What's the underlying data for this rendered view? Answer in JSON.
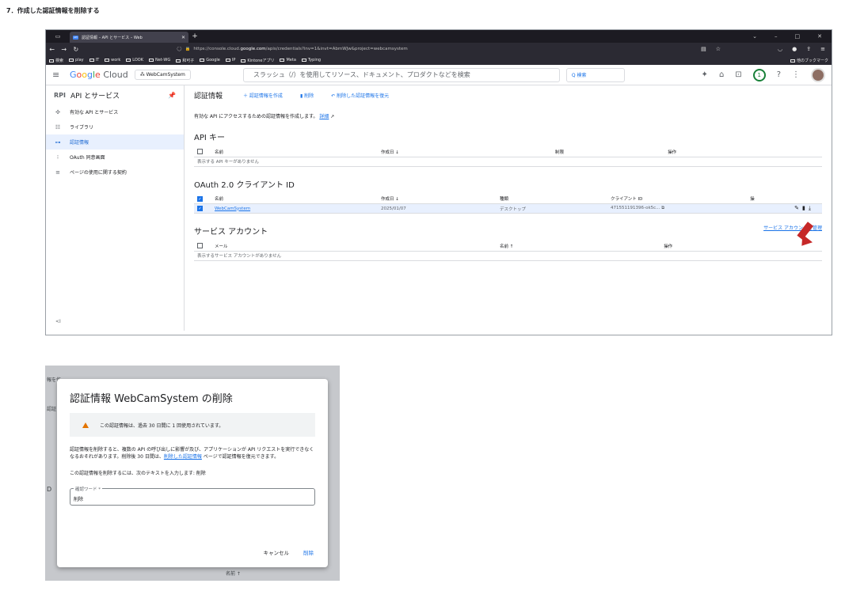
{
  "step_heading": "7．作成した認証情報を削除する",
  "browser": {
    "tab_title": "認証情報 – API とサービス – Web",
    "url_prefix": "https://console.cloud.",
    "url_domain": "google.com",
    "url_rest": "/apis/credentials?inv=1&invt=AbmWJw&project=webcamsystem",
    "bookmarks": [
      "検索",
      "play",
      "IT",
      "work",
      "LOOK",
      "Net-WG",
      "和可子",
      "Google",
      "IP",
      "Kintoneアプリ",
      "Meta",
      "Typing"
    ],
    "bookmarks_other": "他のブックマーク"
  },
  "console": {
    "logo": {
      "g1": "G",
      "g2": "o",
      "g3": "o",
      "g4": "g",
      "g5": "l",
      "g6": "e",
      "rest": " Cloud"
    },
    "project": "WebCamSystem",
    "search_placeholder": "スラッシュ（/）を使用してリソース、ドキュメント、プロダクトなどを検索",
    "search_button": "Q 検索",
    "notification_count": "1"
  },
  "sidebar": {
    "api_logo": "RPI",
    "title": "API とサービス",
    "items": [
      {
        "label": "有効な API とサービス"
      },
      {
        "label": "ライブラリ"
      },
      {
        "label": "認証情報"
      },
      {
        "label": "OAuth 同意画面"
      },
      {
        "label": "ページの使用に関する契約"
      }
    ],
    "collapse": "<I"
  },
  "content": {
    "title": "認証情報",
    "create": "＋ 認証情報を作成",
    "delete": "削除",
    "restore": "削除した認証情報を復元",
    "intro": "有効な API にアクセスするための認証情報を作成します。",
    "intro_link": "詳細",
    "api_keys": {
      "title": "API キー",
      "cols": [
        "名前",
        "作成日 ↓",
        "制限",
        "操作"
      ],
      "empty": "表示する API キーがありません"
    },
    "oauth": {
      "title": "OAuth 2.0 クライアント ID",
      "cols": [
        "名前",
        "作成日 ↓",
        "種類",
        "クライアント ID",
        "操"
      ],
      "row": {
        "name": "WebCamSystem",
        "date": "2025/01/07",
        "type": "デスクトップ",
        "client_id": "471551191396-ok5c..."
      }
    },
    "service_accounts": {
      "title": "サービス アカウント",
      "manage": "サービス アカウントを管理",
      "cols": [
        "メール",
        "名前 ↑",
        "操作"
      ],
      "empty": "表示するサービス アカウントがありません"
    }
  },
  "dialog": {
    "bg_fragments": [
      "報を作",
      "認証",
      "D",
      "名前 ↑"
    ],
    "title": "認証情報 WebCamSystem の削除",
    "warning": "この認証情報は、過去 30 日間に 1 回使用されています。",
    "body_1": "認証情報を削除すると、複数の API の呼び出しに影響が及び、アプリケーションが API リクエストを実行できなくなるおそれがあります。削除後 30 日間は、",
    "body_link": "削除した認証情報",
    "body_2": " ページで認証情報を復元できます。",
    "instruction": "この認証情報を削除するには、次のテキストを入力します: 削除",
    "field_label": "確認ワード *",
    "field_value": "削除",
    "cancel": "キャンセル",
    "confirm": "削除"
  },
  "colors": {
    "accent": "#1a73e8",
    "arrow": "#c62828",
    "warning": "#e37400"
  }
}
